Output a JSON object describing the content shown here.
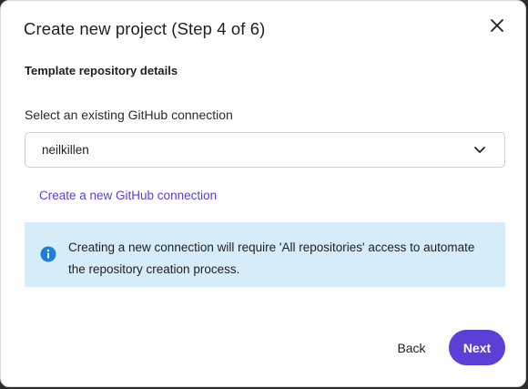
{
  "dialog": {
    "title": "Create new project (Step 4 of 6)",
    "section_heading": "Template repository details"
  },
  "github_connection": {
    "label": "Select an existing GitHub connection",
    "selected_value": "neilkillen",
    "create_link": "Create a new GitHub connection"
  },
  "info": {
    "icon": "info-icon",
    "message": "Creating a new connection will require 'All repositories' access to automate the repository creation process."
  },
  "footer": {
    "back_label": "Back",
    "next_label": "Next"
  },
  "colors": {
    "accent": "#5b3fd6",
    "link": "#5a3fd1",
    "info_background": "#d6ecf8",
    "info_icon": "#1d7fd6"
  }
}
